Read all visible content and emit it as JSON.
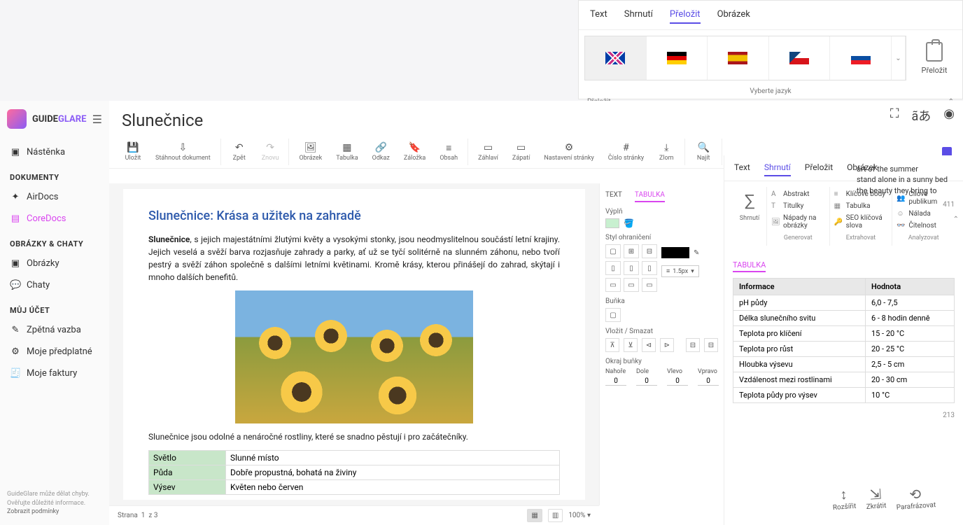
{
  "topPanel": {
    "tabs": [
      "Text",
      "Shrnutí",
      "Přeložit",
      "Obrázek"
    ],
    "activeTab": 2,
    "langCaption": "Vyberte jazyk",
    "translateBtn": "Přeložit",
    "translateFoot": "Přeložit"
  },
  "sidebar": {
    "brand1": "GUIDE",
    "brand2": "GLARE",
    "items": [
      {
        "section": null,
        "label": "Nástěnka",
        "icon": "▣"
      },
      {
        "section": "DOKUMENTY"
      },
      {
        "label": "AirDocs",
        "icon": "✦"
      },
      {
        "label": "CoreDocs",
        "icon": "▤",
        "active": true
      },
      {
        "section": "OBRÁZKY & CHATY"
      },
      {
        "label": "Obrázky",
        "icon": "▣"
      },
      {
        "label": "Chaty",
        "icon": "💬"
      },
      {
        "section": "MŮJ ÚČET"
      },
      {
        "label": "Zpětná vazba",
        "icon": "✎"
      },
      {
        "label": "Moje předplatné",
        "icon": "⚙"
      },
      {
        "label": "Moje faktury",
        "icon": "🧾"
      }
    ],
    "footer1": "GuideGlare může dělat chyby.",
    "footer2": "Ověřujte důležité informace.",
    "footer3": "Zobrazit podmínky"
  },
  "doc": {
    "title": "Slunečnice",
    "toolbar": [
      {
        "grp": [
          {
            "icon": "💾",
            "lbl": "Uložit"
          },
          {
            "icon": "⇩",
            "lbl": "Stáhnout dokument"
          }
        ]
      },
      {
        "grp": [
          {
            "icon": "↶",
            "lbl": "Zpět"
          },
          {
            "icon": "↷",
            "lbl": "Znovu",
            "disabled": true
          }
        ]
      },
      {
        "grp": [
          {
            "icon": "🖼",
            "lbl": "Obrázek"
          },
          {
            "icon": "▦",
            "lbl": "Tabulka"
          },
          {
            "icon": "🔗",
            "lbl": "Odkaz"
          },
          {
            "icon": "🔖",
            "lbl": "Záložka"
          },
          {
            "icon": "≡",
            "lbl": "Obsah"
          }
        ]
      },
      {
        "grp": [
          {
            "icon": "▭",
            "lbl": "Záhlaví"
          },
          {
            "icon": "▭",
            "lbl": "Zápatí"
          },
          {
            "icon": "⚙",
            "lbl": "Nastavení stránky"
          },
          {
            "icon": "#",
            "lbl": "Číslo stránky"
          },
          {
            "icon": "⤓",
            "lbl": "Zlom"
          }
        ]
      },
      {
        "grp": [
          {
            "icon": "🔍",
            "lbl": "Najít"
          }
        ]
      }
    ],
    "heading": "Slunečnice: Krása a užitek na zahradě",
    "para1a": "Slunečnice",
    "para1b": ", s jejich majestátními žlutými květy a vysokými stonky, jsou neodmyslitelnou součástí letní krajiny. Jejich veselá a svěží barva rozjasňuje zahrady a parky, ať už se tyčí solitérně na slunném záhonu, nebo tvoří pestrý a svěží záhon společně s dalšími letními květinami. Kromě krásy, kterou přinášejí do zahrad, skýtají i mnoho dalších benefitů.",
    "para2": "Slunečnice jsou odolné a nenáročné rostliny, které se snadno pěstují i pro začátečníky.",
    "miniTable": [
      [
        "Světlo",
        "Slunné místo"
      ],
      [
        "Půda",
        "Dobře propustná, bohatá na živiny"
      ],
      [
        "Výsev",
        "Květen nebo červen"
      ]
    ],
    "status": {
      "page": "Strana",
      "cur": "1",
      "of": "z",
      "total": "3",
      "zoom": "100%"
    }
  },
  "props": {
    "tabs": [
      "TEXT",
      "TABULKA"
    ],
    "activeTab": 1,
    "fill": "Výplň",
    "borderStyle": "Styl ohraničení",
    "thickness": "1.5px",
    "cell": "Buňka",
    "insertDelete": "Vložit / Smazat",
    "cellMargin": "Okraj buňky",
    "margins": [
      "Nahoře",
      "Dole",
      "Vlevo",
      "Vpravo"
    ],
    "marginVals": [
      "0",
      "0",
      "0",
      "0"
    ]
  },
  "summary": {
    "tabs": [
      "Text",
      "Shrnutí",
      "Přeložit",
      "Obrázek"
    ],
    "activeTab": 1,
    "leftLabel": "Shrnutí",
    "cols": [
      {
        "foot": "Generovat",
        "items": [
          {
            "i": "A",
            "t": "Abstrakt"
          },
          {
            "i": "T",
            "t": "Titulky"
          },
          {
            "i": "🖼",
            "t": "Nápady na obrázky"
          }
        ]
      },
      {
        "foot": "Extrahovat",
        "items": [
          {
            "i": "≡",
            "t": "Klíčové body"
          },
          {
            "i": "▦",
            "t": "Tabulka"
          },
          {
            "i": "🔑",
            "t": "SEO klíčová slova"
          }
        ]
      },
      {
        "foot": "Analyzovat",
        "items": [
          {
            "i": "👥",
            "t": "Cílové publikum"
          },
          {
            "i": "☺",
            "t": "Nálada"
          },
          {
            "i": "👓",
            "t": "Čitelnost"
          }
        ]
      }
    ],
    "tableTab": "TABULKA",
    "tableHead": [
      "Informace",
      "Hodnota"
    ],
    "tableRows": [
      [
        "pH půdy",
        "6,0 - 7,5"
      ],
      [
        "Délka slunečního svitu",
        "6 - 8 hodin denně"
      ],
      [
        "Teplota pro klíčení",
        "15 - 20 °C"
      ],
      [
        "Teplota pro růst",
        "20 - 25 °C"
      ],
      [
        "Hloubka výsevu",
        "2,5 - 5 cm"
      ],
      [
        "Vzdálenost mezi rostlinami",
        "20 - 30 cm"
      ],
      [
        "Teplota půdy pro výsev",
        "10 °C"
      ]
    ],
    "count1": "411",
    "count2": "213"
  },
  "overflow": {
    "t1": "art of the summer",
    "t2": "stand alone in a sunny bed",
    "t3": "the beauty they bring to"
  },
  "floatActions": [
    {
      "i": "↕",
      "t": "Rozšířit"
    },
    {
      "i": "⇲",
      "t": "Zkrátit"
    },
    {
      "i": "⟲",
      "t": "Parafrázovat"
    }
  ]
}
